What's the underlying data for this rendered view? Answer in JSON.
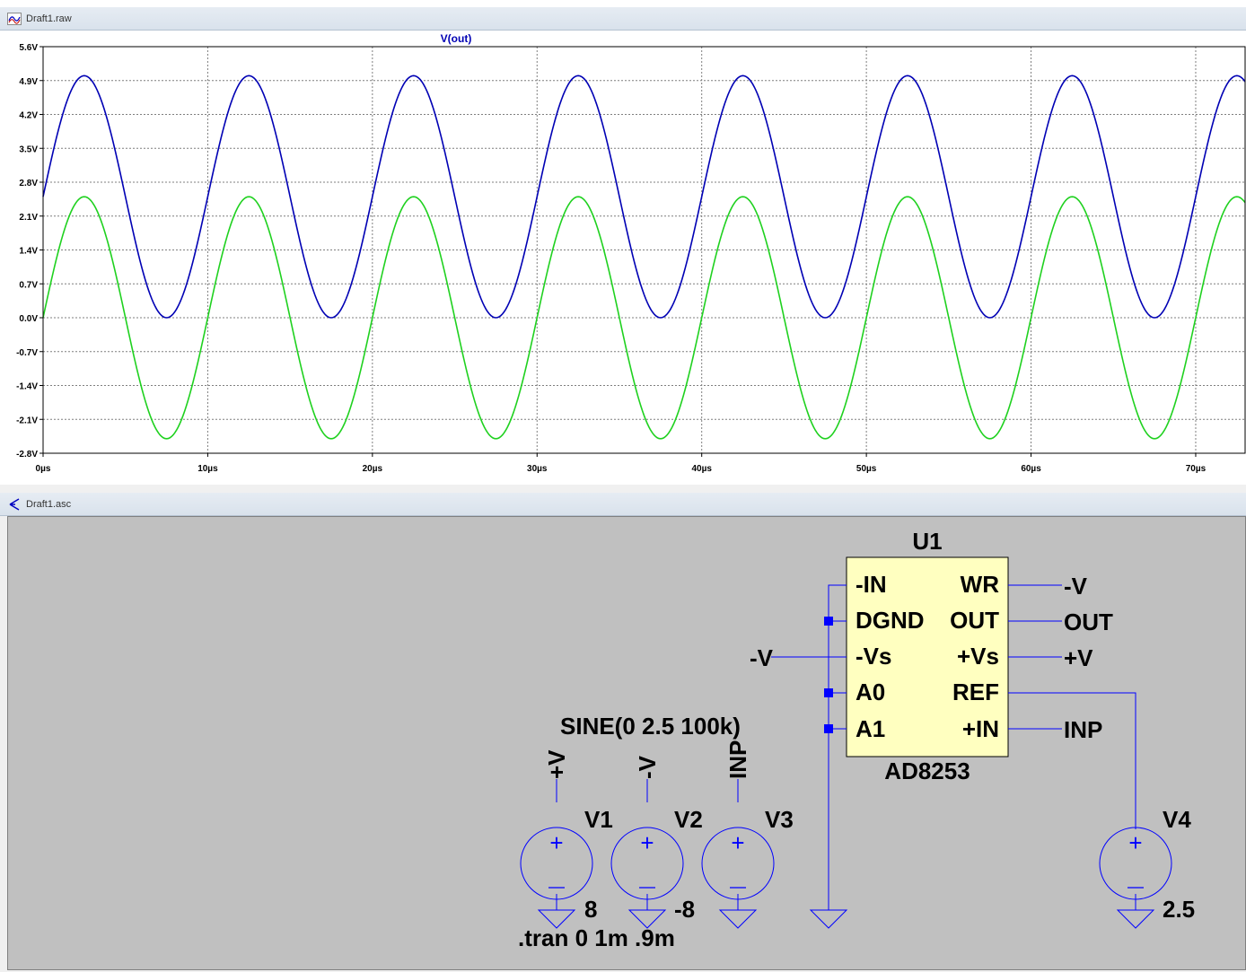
{
  "waveform_window": {
    "title": "Draft1.raw",
    "trace_label": "V(out)",
    "colors": {
      "vout": "#0000b4",
      "vin": "#1fd11f",
      "grid": "#7f7f7f",
      "trace_label": "#0000b4"
    }
  },
  "chart_data": {
    "type": "line",
    "xlabel": "",
    "ylabel": "",
    "xlim": [
      0,
      73
    ],
    "ylim": [
      -2.8,
      5.6
    ],
    "x_ticks": [
      "0µs",
      "10µs",
      "20µs",
      "30µs",
      "40µs",
      "50µs",
      "60µs",
      "70µs"
    ],
    "y_ticks": [
      "5.6V",
      "4.9V",
      "4.2V",
      "3.5V",
      "2.8V",
      "2.1V",
      "1.4V",
      "0.7V",
      "0.0V",
      "-0.7V",
      "-1.4V",
      "-2.1V",
      "-2.8V"
    ],
    "grid": true,
    "series": [
      {
        "name": "V(out)",
        "color": "#0000b4",
        "offset": 2.5,
        "amplitude": 2.5,
        "frequency_hz": 100000
      },
      {
        "color": "#1fd11f",
        "offset": 0,
        "amplitude": 2.5,
        "frequency_hz": 100000
      }
    ]
  },
  "schematic_window": {
    "title": "Draft1.asc",
    "component": {
      "ref": "U1",
      "part": "AD8253",
      "left_pins": [
        "-IN",
        "DGND",
        "-Vs",
        "A0",
        "A1"
      ],
      "right_pins": [
        "WR",
        "OUT",
        "+Vs",
        "REF",
        "+IN"
      ],
      "right_nets": [
        "-V",
        "OUT",
        "+V",
        "",
        "INP"
      ],
      "left_net_label": "-V"
    },
    "sine_label": "SINE(0 2.5 100k)",
    "tran_label": ".tran 0 1m .9m",
    "sources": [
      {
        "ref": "V1",
        "net": "+V",
        "value": "8"
      },
      {
        "ref": "V2",
        "net": "-V",
        "value": "-8"
      },
      {
        "ref": "V3",
        "net": "INP",
        "value": ""
      },
      {
        "ref": "V4",
        "net": "",
        "value": "2.5"
      }
    ],
    "colors": {
      "wire": "#0000ff",
      "component_fill": "#ffffc0",
      "background": "#c0c0c0"
    }
  }
}
